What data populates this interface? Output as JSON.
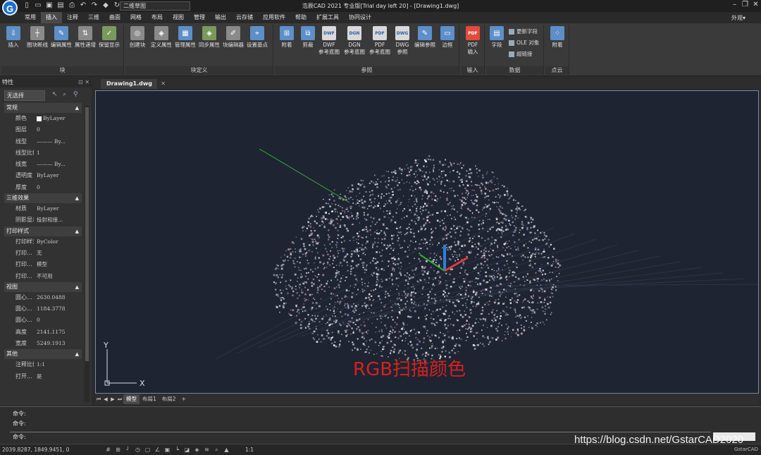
{
  "titlebar": {
    "app_logo": "G",
    "workspace": "二维草图",
    "window_title": "浩辰CAD 2021 专业版[Trial day left 20] - [Drawing1.dwg]"
  },
  "menu": {
    "tabs": [
      "常用",
      "插入",
      "注释",
      "三维",
      "曲面",
      "网格",
      "布局",
      "视图",
      "管理",
      "输出",
      "云存储",
      "应用软件",
      "帮助",
      "扩展工具",
      "协同设计"
    ],
    "active_index": 1,
    "appearance": "外观"
  },
  "ribbon": {
    "block": {
      "label": "块",
      "buttons": [
        "插入",
        "图块断线",
        "编辑属性",
        "属性递增",
        "保留显示"
      ]
    },
    "block_def": {
      "label": "块定义",
      "buttons": [
        "创建块",
        "定义属性",
        "管理属性",
        "同步属性",
        "块编辑器",
        "设置基点"
      ]
    },
    "reference": {
      "label": "参照",
      "buttons": [
        "附着",
        "剪裁",
        "DWF\n参考底图",
        "DGN\n参考底图",
        "PDF\n参考底图",
        "DWG\n参照",
        "编辑参照",
        "边框"
      ]
    },
    "import": {
      "label": "输入",
      "buttons": [
        "PDF\n输入"
      ]
    },
    "data": {
      "label": "数据",
      "field": "字段",
      "update_field": "更新字段",
      "ole": "OLE 对象",
      "hyperlink": "超链接"
    },
    "pointcloud": {
      "label": "点云",
      "attach": "附着"
    }
  },
  "properties": {
    "title": "特性",
    "selection": "无选择",
    "sections": [
      {
        "name": "常规",
        "rows": [
          {
            "label": "颜色",
            "value": "ByLayer"
          },
          {
            "label": "图层",
            "value": "0"
          },
          {
            "label": "线型",
            "value": "——— By..."
          },
          {
            "label": "线型比例",
            "value": "1"
          },
          {
            "label": "线宽",
            "value": "——— By..."
          },
          {
            "label": "透明度",
            "value": "ByLayer"
          },
          {
            "label": "厚度",
            "value": "0"
          }
        ]
      },
      {
        "name": "三维效果",
        "rows": [
          {
            "label": "材质",
            "value": "ByLayer"
          },
          {
            "label": "阴影显示",
            "value": "投射和接..."
          }
        ]
      },
      {
        "name": "打印样式",
        "rows": [
          {
            "label": "打印样式",
            "value": "ByColor"
          },
          {
            "label": "打印...",
            "value": "无"
          },
          {
            "label": "打印...",
            "value": "模型"
          },
          {
            "label": "打印...",
            "value": "不可用"
          }
        ]
      },
      {
        "name": "视图",
        "rows": [
          {
            "label": "圆心...",
            "value": "2630.0488"
          },
          {
            "label": "圆心...",
            "value": "1184.3778"
          },
          {
            "label": "圆心...",
            "value": "0"
          },
          {
            "label": "高度",
            "value": "2141.1175"
          },
          {
            "label": "宽度",
            "value": "5249.1913"
          }
        ]
      },
      {
        "name": "其他",
        "rows": [
          {
            "label": "注释比例",
            "value": "1:1"
          },
          {
            "label": "打开...",
            "value": "是"
          }
        ]
      }
    ]
  },
  "document": {
    "tab": "Drawing1.dwg",
    "overlay_text": "RGB扫描颜色",
    "ucs_x": "X",
    "ucs_y": "Y"
  },
  "layout_tabs": [
    "模型",
    "布局1",
    "布局2",
    "+"
  ],
  "command": {
    "history": [
      "命令:",
      "命令:"
    ],
    "prompt": "命令:"
  },
  "status": {
    "coords": "2039.8287, 1849.9451, 0",
    "scale": "1:1",
    "brand": "GstarCAD",
    "watermark": "https://blog.csdn.net/GstarCAD2020"
  },
  "colors": {
    "canvas_bg": "#1e2432",
    "overlay_text": "#d4211f",
    "axis_x": "#e03a3a",
    "axis_y": "#2fb02f",
    "axis_z": "#2d7fe0"
  }
}
